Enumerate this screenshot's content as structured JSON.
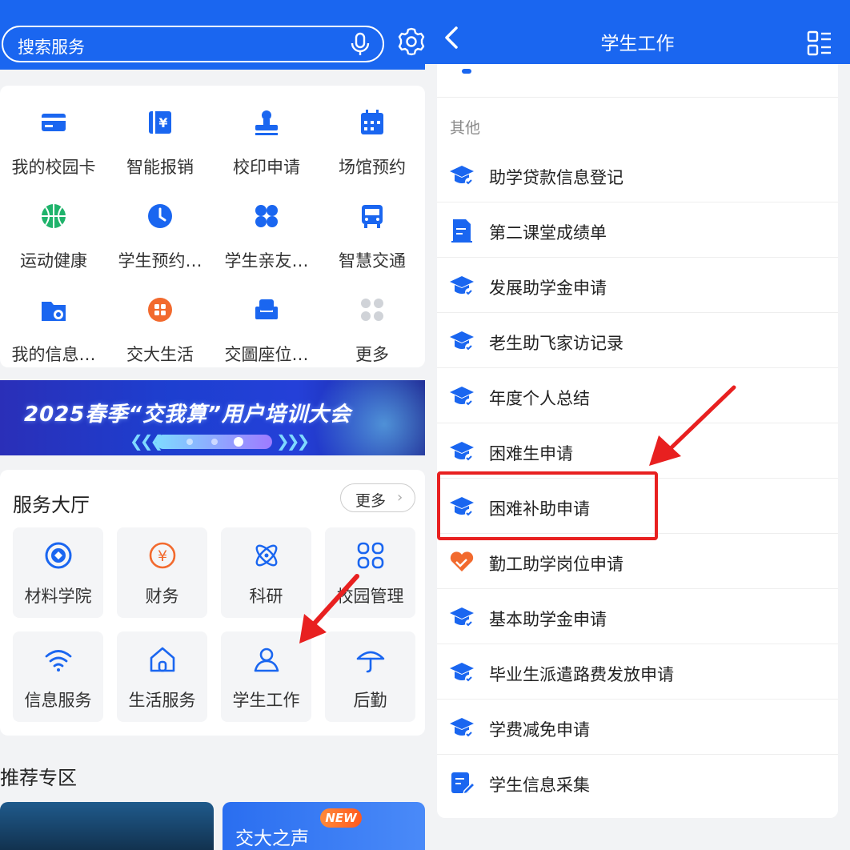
{
  "left": {
    "search": {
      "placeholder": "搜索服务"
    },
    "quick_items": [
      {
        "label": "我的校园卡",
        "icon": "card-icon"
      },
      {
        "label": "智能报销",
        "icon": "reimburse-icon"
      },
      {
        "label": "校印申请",
        "icon": "stamp-icon"
      },
      {
        "label": "场馆预约",
        "icon": "calendar-icon"
      },
      {
        "label": "运动健康",
        "icon": "basketball-icon"
      },
      {
        "label": "学生预约…",
        "icon": "clock-icon"
      },
      {
        "label": "学生亲友…",
        "icon": "clover-icon"
      },
      {
        "label": "智慧交通",
        "icon": "bus-icon"
      },
      {
        "label": "我的信息…",
        "icon": "folder-settings-icon"
      },
      {
        "label": "交大生活",
        "icon": "grid-circle-icon"
      },
      {
        "label": "交圖座位…",
        "icon": "seat-icon"
      },
      {
        "label": "更多",
        "icon": "more-dots-icon"
      }
    ],
    "banner": {
      "title": "2025春季“交我算”用户培训大会"
    },
    "hall": {
      "title": "服务大厅",
      "more_label": "更多",
      "tiles": [
        {
          "label": "材料学院",
          "icon": "college-emblem-icon"
        },
        {
          "label": "财务",
          "icon": "yuan-icon"
        },
        {
          "label": "科研",
          "icon": "atom-icon"
        },
        {
          "label": "校园管理",
          "icon": "four-squares-icon"
        },
        {
          "label": "信息服务",
          "icon": "wifi-icon"
        },
        {
          "label": "生活服务",
          "icon": "home-icon"
        },
        {
          "label": "学生工作",
          "icon": "user-icon"
        },
        {
          "label": "后勤",
          "icon": "umbrella-icon"
        }
      ]
    },
    "recommend": {
      "title": "推荐专区",
      "card2_label": "交大之声",
      "badge": "NEW"
    }
  },
  "right": {
    "title": "学生工作",
    "section": "其他",
    "items": [
      {
        "label": "助学贷款信息登记",
        "icon": "graduation-cap-icon"
      },
      {
        "label": "第二课堂成绩单",
        "icon": "document-edit-icon"
      },
      {
        "label": "发展助学金申请",
        "icon": "graduation-cap-icon"
      },
      {
        "label": "老生助飞家访记录",
        "icon": "graduation-cap-icon"
      },
      {
        "label": "年度个人总结",
        "icon": "graduation-cap-icon"
      },
      {
        "label": "困难生申请",
        "icon": "graduation-cap-icon"
      },
      {
        "label": "困难补助申请",
        "icon": "graduation-cap-icon"
      },
      {
        "label": "勤工助学岗位申请",
        "icon": "heart-hand-icon"
      },
      {
        "label": "基本助学金申请",
        "icon": "graduation-cap-icon"
      },
      {
        "label": "毕业生派遣路费发放申请",
        "icon": "graduation-cap-icon"
      },
      {
        "label": "学费减免申请",
        "icon": "graduation-cap-icon"
      },
      {
        "label": "学生信息采集",
        "icon": "form-pen-icon"
      }
    ]
  },
  "colors": {
    "primary": "#1a66f0",
    "highlight": "#e82020",
    "orange": "#f26a2e",
    "green": "#1fb36b"
  }
}
